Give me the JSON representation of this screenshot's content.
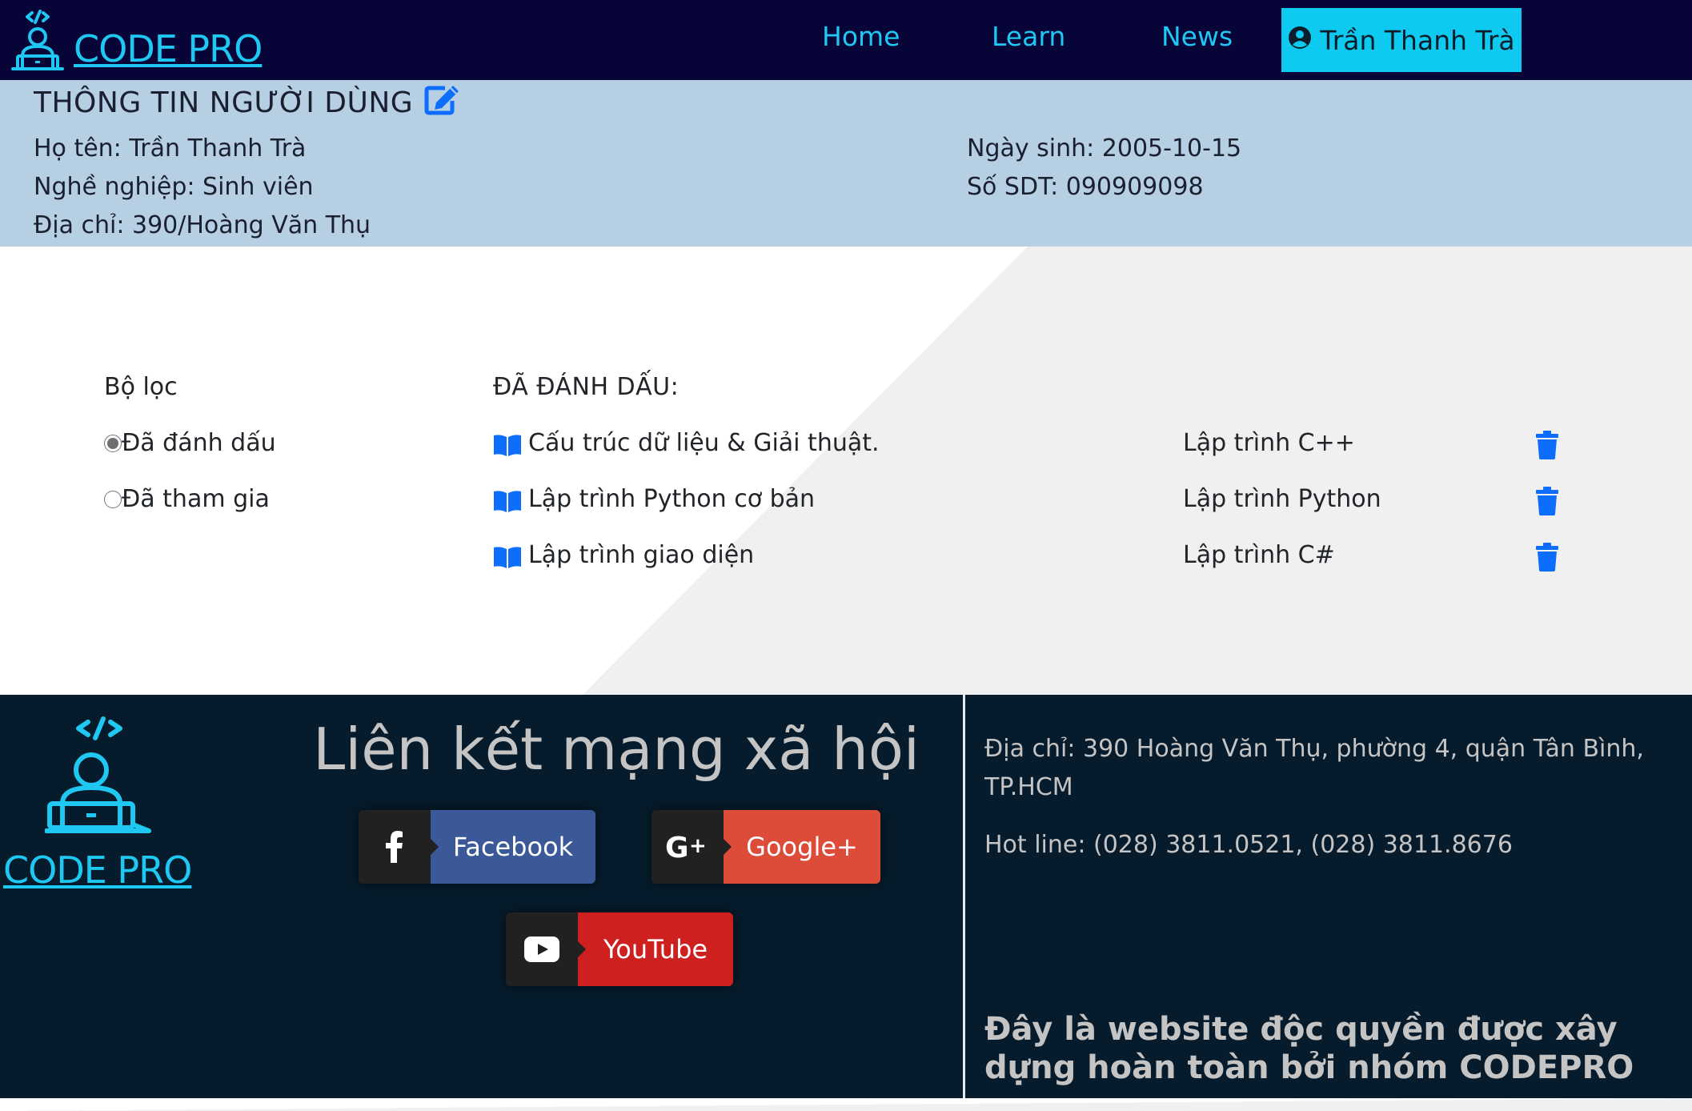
{
  "nav": {
    "brand": "CODE PRO",
    "links": [
      "Home",
      "Learn",
      "News"
    ],
    "user_name": "Trần Thanh Trà"
  },
  "profile": {
    "title": "THÔNG TIN NGƯỜI DÙNG",
    "name": "Họ tên: Trần Thanh Trà",
    "job": "Nghề nghiệp: Sinh viên",
    "address": "Địa chỉ: 390/Hoàng Văn Thụ",
    "birthday": "Ngày sinh: 2005-10-15",
    "phone": "Số SDT: 090909098"
  },
  "filter": {
    "title": "Bộ lọc",
    "options": [
      {
        "label": "Đã đánh dấu",
        "checked": true
      },
      {
        "label": "Đã tham gia",
        "checked": false
      }
    ]
  },
  "bookmarks": {
    "title": "ĐÃ ĐÁNH DẤU:",
    "items": [
      {
        "course": "Cấu trúc dữ liệu & Giải thuật.",
        "category": "Lập trình C++"
      },
      {
        "course": "Lập trình Python cơ bản",
        "category": "Lập trình Python"
      },
      {
        "course": "Lập trình giao diện",
        "category": "Lập trình C#"
      }
    ]
  },
  "footer": {
    "brand": "CODE PRO",
    "social_title": "Liên kết mạng xã hội",
    "social": [
      {
        "label": "Facebook",
        "color": "#3b5998"
      },
      {
        "label": "Google+",
        "color": "#dd4b39"
      },
      {
        "label": "YouTube",
        "color": "#cd201f"
      }
    ],
    "address": "Địa chỉ: 390 Hoàng Văn Thụ, phường 4, quận Tân Bình, TP.HCM",
    "hotline": "Hot line: (028) 3811.0521, (028) 3811.8676",
    "claim": "Đây là website độc quyền được xây dựng hoàn toàn bởi nhóm CODEPRO"
  },
  "colors": {
    "navbar": "#070438",
    "accent": "#1ec8f2",
    "info_bg": "#b7cfe3",
    "footer_bg": "#061b2b",
    "icon_blue": "#0d6efd"
  }
}
